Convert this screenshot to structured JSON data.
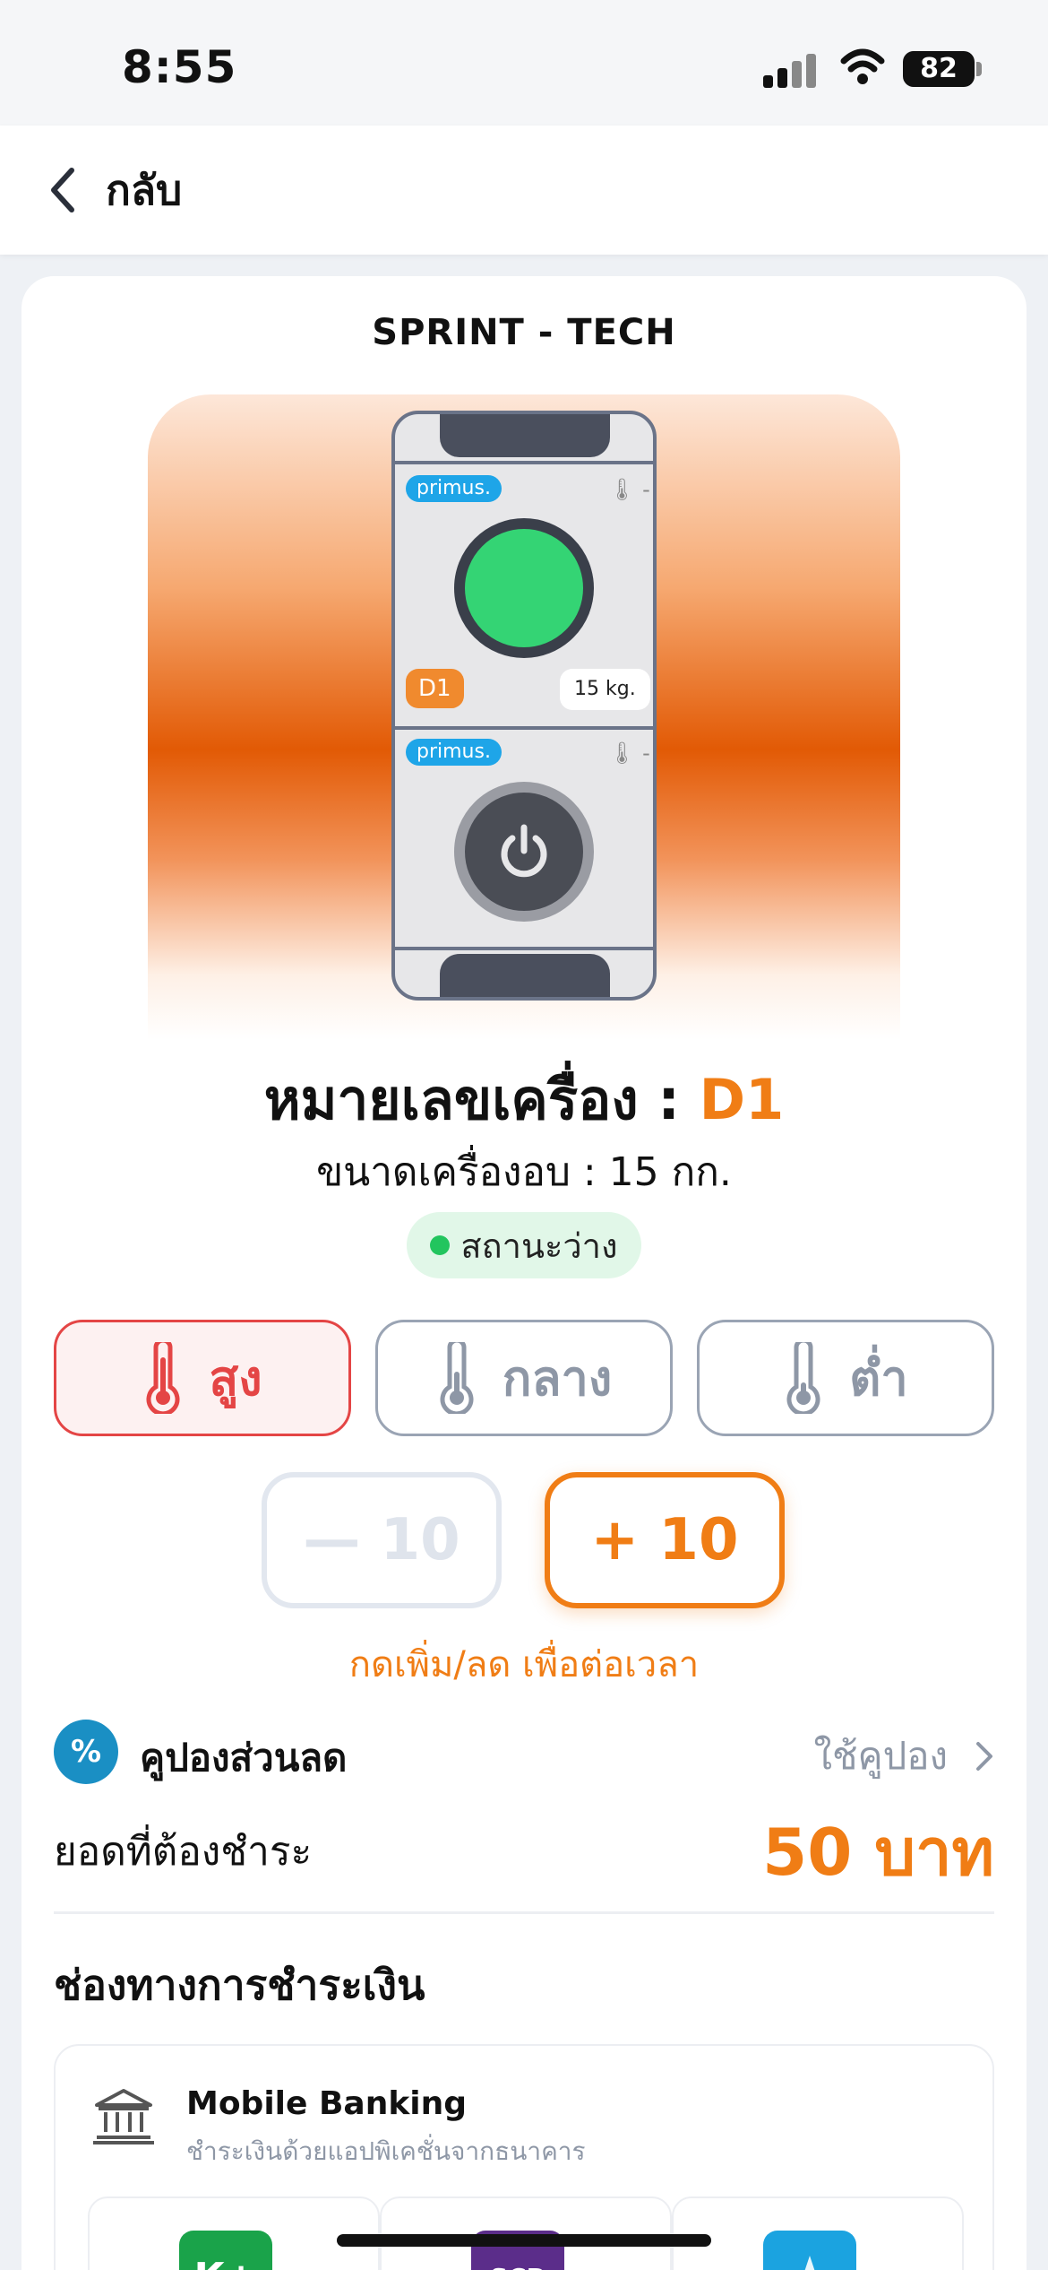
{
  "status_bar": {
    "time": "8:55",
    "battery": "82"
  },
  "nav": {
    "back_label": "กลับ"
  },
  "brand": "SPRINT - TECH",
  "machine": {
    "upper_badge": "primus.",
    "lower_badge": "primus.",
    "thermo_upper": "🌡 -",
    "thermo_lower": "🌡 -",
    "code_tag": "D1",
    "weight_tag": "15 kg."
  },
  "details": {
    "machine_no_label": "หมายเลขเครื่อง : ",
    "machine_no_code": "D1",
    "size": "ขนาดเครื่องอบ : 15 กก.",
    "status": "สถานะว่าง"
  },
  "temperature": {
    "options": [
      "สูง",
      "กลาง",
      "ต่ำ"
    ],
    "selected": "สูง",
    "active_color": "#e44545"
  },
  "time_adjust": {
    "minus_label": "— 10",
    "plus_label": "+ 10",
    "hint": "กดเพิ่ม/ลด เพื่อต่อเวลา"
  },
  "coupon": {
    "icon": "coupon-icon",
    "label": "คูปองส่วนลด",
    "link": "ใช้คูปอง"
  },
  "total": {
    "label": "ยอดที่ต้องชำระ",
    "value": "50 บาท"
  },
  "payment": {
    "title": "ช่องทางการชำระเงิน",
    "mobile_banking_title": "Mobile Banking",
    "mobile_banking_sub": "ชำระเงินด้วยแอปพิเคชั่นจากธนาคาร",
    "banks": [
      {
        "name": "K+",
        "color": "#1aa34a"
      },
      {
        "name": "SCB",
        "color": "#5b2d8a"
      },
      {
        "name": "Krungthai",
        "color": "#1ba3e0"
      }
    ]
  },
  "colors": {
    "accent": "#f07d15",
    "available": "#22c55e"
  }
}
